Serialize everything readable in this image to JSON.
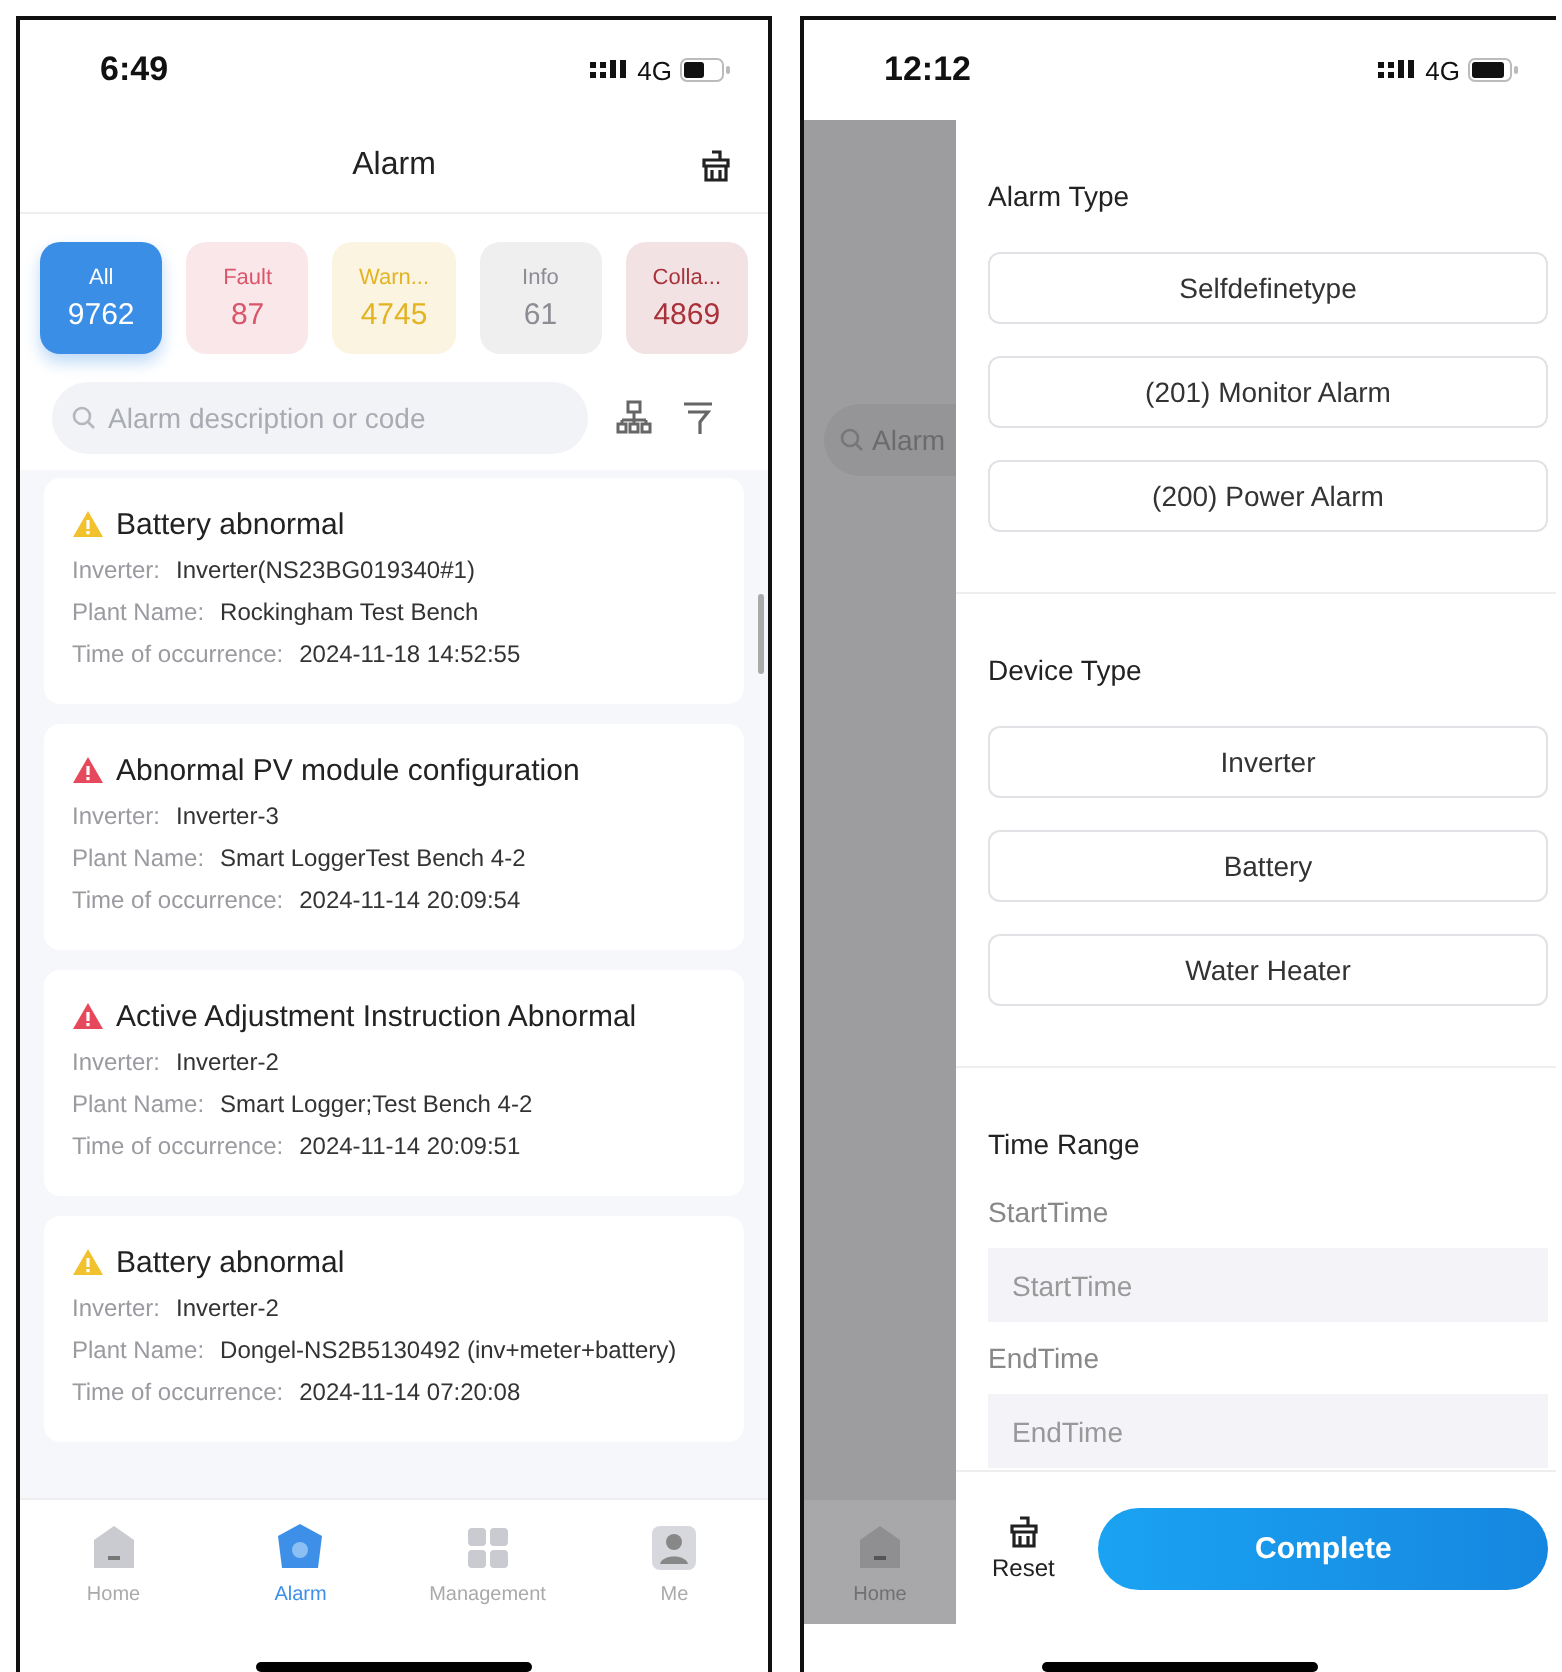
{
  "alarm_list_screen": {
    "status_bar": {
      "time": "6:49",
      "network": "4G"
    },
    "header": {
      "title": "Alarm"
    },
    "tiles": [
      {
        "label": "All",
        "count": "9762",
        "selected": true,
        "color": "#3a8ee6"
      },
      {
        "label": "Fault",
        "count": "87",
        "selected": false,
        "color": "#d9566a"
      },
      {
        "label": "Warn...",
        "count": "4745",
        "selected": false,
        "color": "#e3b324"
      },
      {
        "label": "Info",
        "count": "61",
        "selected": false,
        "color": "#8c8c94"
      },
      {
        "label": "Colla...",
        "count": "4869",
        "selected": false,
        "color": "#a8323a"
      }
    ],
    "search": {
      "placeholder": "Alarm description or code"
    },
    "alarms": [
      {
        "title": "Battery abnormal",
        "color": "#f2c12e",
        "fields": [
          {
            "label": "Inverter:",
            "value": "Inverter(NS23BG019340#1)"
          },
          {
            "label": "Plant Name:",
            "value": "Rockingham Test Bench"
          },
          {
            "label": "Time of occurrence:",
            "value": "2024-11-18 14:52:55"
          }
        ]
      },
      {
        "title": "Abnormal PV module configuration",
        "color": "#e6485c",
        "fields": [
          {
            "label": "Inverter:",
            "value": "Inverter-3"
          },
          {
            "label": "Plant Name:",
            "value": "Smart LoggerTest Bench 4-2"
          },
          {
            "label": "Time of occurrence:",
            "value": "2024-11-14 20:09:54"
          }
        ]
      },
      {
        "title": "Active Adjustment Instruction Abnormal",
        "color": "#e6485c",
        "fields": [
          {
            "label": "Inverter:",
            "value": "Inverter-2"
          },
          {
            "label": "Plant Name:",
            "value": "Smart Logger;Test Bench 4-2"
          },
          {
            "label": "Time of occurrence:",
            "value": "2024-11-14 20:09:51"
          }
        ]
      },
      {
        "title": "Battery abnormal",
        "color": "#f2c12e",
        "fields": [
          {
            "label": "Inverter:",
            "value": "Inverter-2"
          },
          {
            "label": "Plant Name:",
            "value": "Dongel-NS2B5130492 (inv+meter+battery)"
          },
          {
            "label": "Time of occurrence:",
            "value": "2024-11-14 07:20:08"
          }
        ]
      }
    ],
    "nav": [
      {
        "label": "Home",
        "kind": "home",
        "selected": false
      },
      {
        "label": "Alarm",
        "kind": "alarm",
        "selected": true
      },
      {
        "label": "Management",
        "kind": "grid",
        "selected": false
      },
      {
        "label": "Me",
        "kind": "person",
        "selected": false
      }
    ]
  },
  "filter_screen": {
    "status_bar": {
      "time": "12:12",
      "network": "4G"
    },
    "background": {
      "search_text": "Alarm",
      "nav_label": "Home"
    },
    "sections": [
      {
        "title": "Alarm Type",
        "kind": "options",
        "options": [
          "Selfdefinetype",
          "(201) Monitor Alarm",
          "(200) Power Alarm"
        ]
      },
      {
        "title": "Device Type",
        "kind": "options",
        "options": [
          "Inverter",
          "Battery",
          "Water Heater"
        ]
      },
      {
        "title": "Time Range",
        "kind": "time",
        "fields": [
          {
            "label": "StartTime",
            "placeholder": "StartTime"
          },
          {
            "label": "EndTime",
            "placeholder": "EndTime"
          }
        ]
      }
    ],
    "footer": {
      "reset": "Reset",
      "complete": "Complete"
    }
  }
}
